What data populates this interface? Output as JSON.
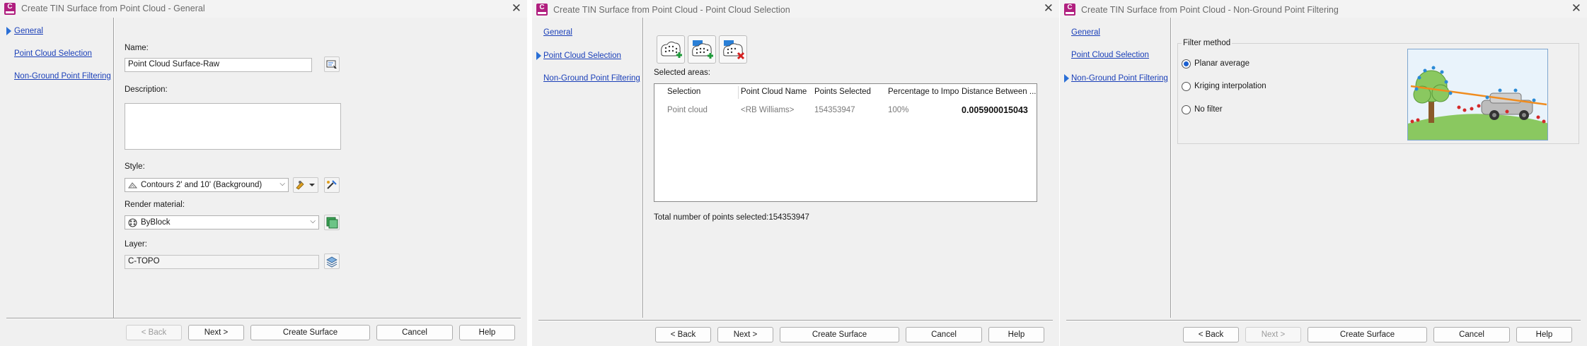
{
  "dialog_general": {
    "title": "Create TIN Surface from Point Cloud - General",
    "nav": [
      "General",
      "Point Cloud Selection",
      "Non-Ground Point Filtering"
    ],
    "name_label": "Name:",
    "name_value": "Point Cloud Surface-Raw",
    "description_label": "Description:",
    "description_value": "",
    "style_label": "Style:",
    "style_value": "Contours 2' and 10' (Background)",
    "render_label": "Render material:",
    "render_value": "ByBlock",
    "layer_label": "Layer:",
    "layer_value": "C-TOPO",
    "buttons": {
      "back": "< Back",
      "next": "Next >",
      "create": "Create Surface",
      "cancel": "Cancel",
      "help": "Help"
    }
  },
  "dialog_selection": {
    "title": "Create TIN Surface from Point Cloud - Point Cloud Selection",
    "nav": [
      "General",
      "Point Cloud Selection",
      "Non-Ground Point Filtering"
    ],
    "selected_areas_label": "Selected areas:",
    "columns": [
      "Selection",
      "Point Cloud Name",
      "Points Selected",
      "Percentage to Import",
      "Distance Between ..."
    ],
    "rows": [
      {
        "selection": "Point cloud",
        "name": "<RB Williams>",
        "points": "154353947",
        "percent": "100%",
        "distance": "0.005900015043"
      }
    ],
    "total_label": "Total number of points selected:154353947",
    "buttons": {
      "back": "< Back",
      "next": "Next >",
      "create": "Create Surface",
      "cancel": "Cancel",
      "help": "Help"
    }
  },
  "dialog_filtering": {
    "title": "Create TIN Surface from Point Cloud - Non-Ground Point Filtering",
    "nav": [
      "General",
      "Point Cloud Selection",
      "Non-Ground Point Filtering"
    ],
    "filter_method_label": "Filter method",
    "options": [
      "Planar average",
      "Kriging interpolation",
      "No filter"
    ],
    "selected_option": "Planar average",
    "buttons": {
      "back": "< Back",
      "next": "Next >",
      "create": "Create Surface",
      "cancel": "Cancel",
      "help": "Help"
    }
  },
  "colors": {
    "link": "#1a3fb8",
    "nav_arrow": "#2a6fd6",
    "app_icon": "#b01f7f",
    "dialog_bg": "#f0f0f0"
  }
}
